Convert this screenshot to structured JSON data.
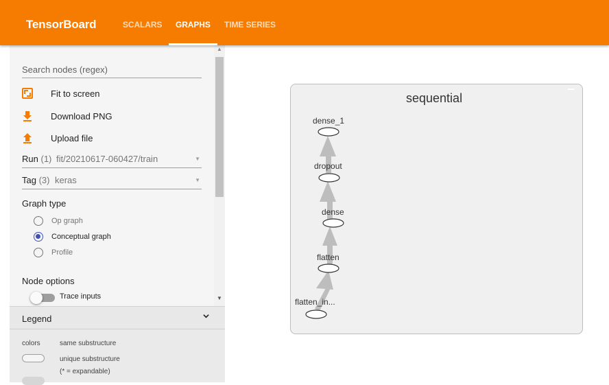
{
  "app": {
    "title": "TensorBoard",
    "tabs": [
      {
        "label": "SCALARS",
        "active": false
      },
      {
        "label": "GRAPHS",
        "active": true
      },
      {
        "label": "TIME SERIES",
        "active": false
      }
    ],
    "accent_color": "#f57c00"
  },
  "sidebar": {
    "search_placeholder": "Search nodes (regex)",
    "actions": [
      {
        "label": "Fit to screen",
        "icon": "fit-to-screen-icon"
      },
      {
        "label": "Download PNG",
        "icon": "download-icon"
      },
      {
        "label": "Upload file",
        "icon": "upload-icon"
      }
    ],
    "run": {
      "label": "Run",
      "count": "(1)",
      "value": "fit/20210617-060427/train"
    },
    "tag": {
      "label": "Tag",
      "count": "(3)",
      "value": "keras"
    },
    "graph_type": {
      "title": "Graph type",
      "options": [
        {
          "label": "Op graph",
          "checked": false
        },
        {
          "label": "Conceptual graph",
          "checked": true
        },
        {
          "label": "Profile",
          "checked": false
        }
      ]
    },
    "node_options": {
      "title": "Node options",
      "trace_inputs_label": "Trace inputs",
      "trace_inputs_on": false
    },
    "legend": {
      "title": "Legend",
      "colors_label": "colors",
      "same_substructure": "same substructure",
      "unique_substructure": "unique substructure",
      "expandable_note": "(* = expandable)"
    }
  },
  "graph": {
    "scope_name": "sequential",
    "nodes": [
      "dense_1",
      "dropout",
      "dense",
      "flatten",
      "flatten_in..."
    ]
  }
}
